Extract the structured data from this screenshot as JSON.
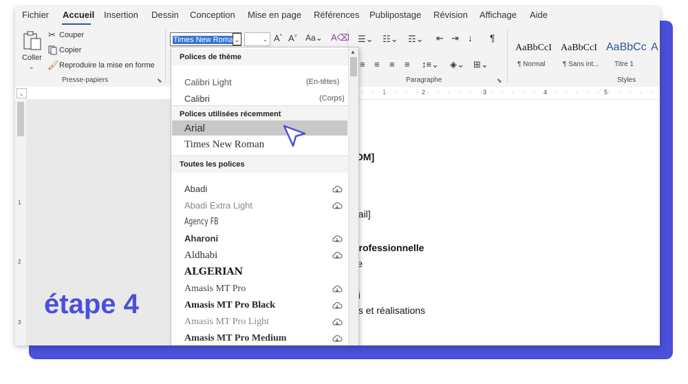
{
  "menu": {
    "tabs": [
      "Fichier",
      "Accueil",
      "Insertion",
      "Dessin",
      "Conception",
      "Mise en page",
      "Références",
      "Publipostage",
      "Révision",
      "Affichage",
      "Aide"
    ],
    "active_index": 1
  },
  "clipboard": {
    "paste_label": "Coller",
    "cut_label": "Couper",
    "copy_label": "Copier",
    "format_painter_label": "Reproduire la mise en forme",
    "group_label": "Presse-papiers"
  },
  "font": {
    "current_font": "Times New Roman"
  },
  "paragraph": {
    "group_label": "Paragraphe"
  },
  "styles": {
    "items": [
      {
        "sample": "AaBbCcI",
        "name": "¶ Normal"
      },
      {
        "sample": "AaBbCcI",
        "name": "¶ Sans int..."
      },
      {
        "sample": "AaBbCc",
        "name": "Titre 1"
      },
      {
        "sample": "A",
        "name": ""
      }
    ],
    "group_label": "Styles",
    "title_color": "#2f5597"
  },
  "dropdown": {
    "theme_header": "Polices de thème",
    "theme_fonts": [
      {
        "name": "Calibri Light",
        "note": "(En-têtes)"
      },
      {
        "name": "Calibri",
        "note": "(Corps)"
      }
    ],
    "recent_header": "Polices utilisées récemment",
    "recent_fonts": [
      "Arial",
      "Times New Roman"
    ],
    "highlighted_font": "Arial",
    "all_header": "Toutes les polices",
    "all_fonts": [
      "Abadi",
      "Abadi Extra Light",
      "Agency FB",
      "Aharoni",
      "Aldhabi",
      "ALGERIAN",
      "Amasis MT Pro",
      "Amasis MT Pro Black",
      "Amasis MT Pro Light",
      "Amasis MT Pro Medium"
    ]
  },
  "document": {
    "lines": [
      "IOM]",
      "nail]",
      "professionnelle",
      "lle",
      "bi",
      "és et réalisations"
    ]
  },
  "ruler": {
    "marks": [
      "1",
      "2",
      "3",
      "4",
      "5"
    ],
    "left_marks": [
      "1",
      "2",
      "3"
    ]
  },
  "overlay": {
    "step_label": "étape 4"
  },
  "colors": {
    "accent": "#4a50d9",
    "selection": "#3575d4",
    "ribbon_bg": "#f3f3f3"
  }
}
